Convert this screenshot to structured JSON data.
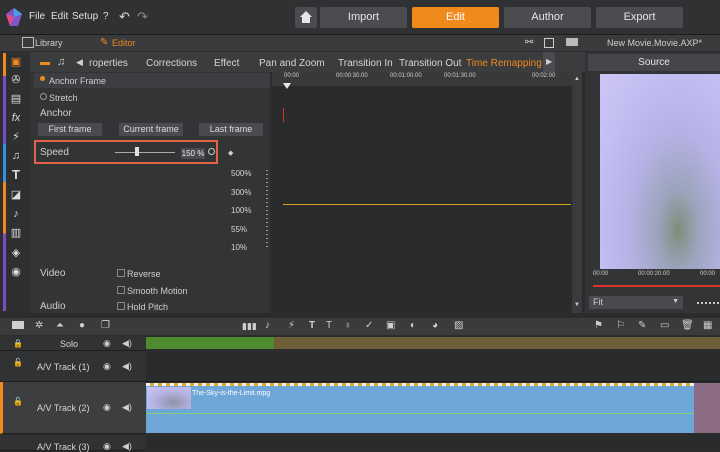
{
  "menu": {
    "file": "File",
    "edit": "Edit",
    "setup": "Setup",
    "help": "?"
  },
  "nav": {
    "import": "Import",
    "edit": "Edit",
    "author": "Author",
    "export": "Export"
  },
  "subtabs": {
    "library": "Library",
    "editor": "Editor"
  },
  "project_title": "New Movie.Movie.AXP*",
  "source_label": "Source",
  "editor_tabs": [
    "roperties",
    "Corrections",
    "Effect",
    "Pan and Zoom",
    "Transition In",
    "Transition Out",
    "Time Remapping"
  ],
  "remap": {
    "anchor_frame": "Anchor Frame",
    "stretch": "Stretch",
    "anchor_label": "Anchor",
    "first_frame": "First frame",
    "current_frame": "Current frame",
    "last_frame": "Last frame",
    "speed_label": "Speed",
    "speed_value": "150 %",
    "speed_fraction": 0.33,
    "percent_marks": [
      "500%",
      "300%",
      "100%",
      "55%",
      "10%"
    ],
    "video_label": "Video",
    "audio_label": "Audio",
    "reverse": "Reverse",
    "smooth_motion": "Smooth Motion",
    "hold_pitch": "Hold Pitch"
  },
  "ruler": [
    "00:00",
    "00:00:30.00",
    "00:01:00.00",
    "00:01:30.00",
    "00:02:00"
  ],
  "source_ruler": [
    "00:00",
    "00:00:20.00",
    "00:00"
  ],
  "fit_label": "Fit",
  "tracks": {
    "solo": "Solo",
    "track1": "A/V Track (1)",
    "track2": "A/V Track (2)",
    "track3": "A/V Track (3)",
    "clip_name": "The-Sky-is-the-Limit.mpg"
  },
  "colors": {
    "accent": "#f08a1c",
    "highlight_box": "#e0634a",
    "speed_line": "#d6a418",
    "clip": "#6ea6d8",
    "playhead": "#d8342a"
  }
}
